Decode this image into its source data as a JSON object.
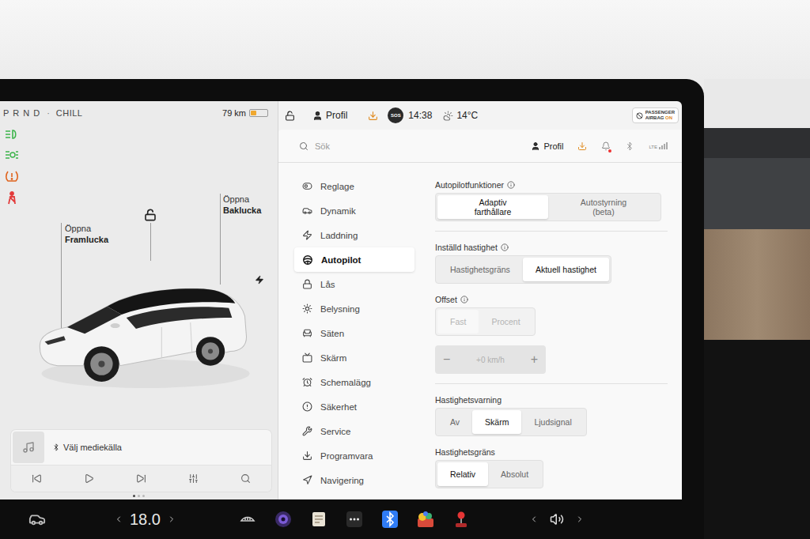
{
  "status_left": {
    "gears": "P R N D",
    "separator": "·",
    "drive_mode": "CHILL",
    "range": "79 km",
    "battery_level": 0.35
  },
  "status_right": {
    "locked": false,
    "profile": "Profil",
    "update_available": true,
    "sos": "SOS",
    "time": "14:38",
    "temperature": "14°C",
    "airbag": {
      "line1": "PASSENGER",
      "line2": "AIRBAG",
      "state": "ON"
    }
  },
  "car_view": {
    "locked": false,
    "callouts": [
      {
        "action": "Öppna",
        "part": "Framlucka"
      },
      {
        "action": "Öppna",
        "part": "Baklucka"
      }
    ]
  },
  "media": {
    "source": "Välj mediekälla",
    "page_dots": [
      {
        "selected": true
      },
      {
        "selected": false
      },
      {
        "selected": false
      }
    ]
  },
  "settings_header": {
    "search_placeholder": "Sök",
    "profile": "Profil",
    "network": "LTE"
  },
  "sidebar": {
    "items": [
      {
        "label": "Reglage",
        "selected": false
      },
      {
        "label": "Dynamik",
        "selected": false
      },
      {
        "label": "Laddning",
        "selected": false
      },
      {
        "label": "Autopilot",
        "selected": true
      },
      {
        "label": "Lås",
        "selected": false
      },
      {
        "label": "Belysning",
        "selected": false
      },
      {
        "label": "Säten",
        "selected": false
      },
      {
        "label": "Skärm",
        "selected": false
      },
      {
        "label": "Schemalägg",
        "selected": false
      },
      {
        "label": "Säkerhet",
        "selected": false
      },
      {
        "label": "Service",
        "selected": false
      },
      {
        "label": "Programvara",
        "selected": false
      },
      {
        "label": "Navigering",
        "selected": false
      }
    ]
  },
  "settings": {
    "sections": [
      {
        "label": "Autopilotfunktioner",
        "info": true,
        "disabled": false,
        "kind": "wide",
        "divider_after": true,
        "options": [
          {
            "label": "Adaptiv farthållare",
            "selected": true
          },
          {
            "label": "Autostyrning (beta)",
            "selected": false
          }
        ]
      },
      {
        "label": "Inställd hastighet",
        "info": true,
        "disabled": false,
        "kind": "fit",
        "divider_after": false,
        "options": [
          {
            "label": "Hastighetsgräns",
            "selected": false
          },
          {
            "label": "Aktuell hastighet",
            "selected": true
          }
        ]
      },
      {
        "label": "Offset",
        "info": true,
        "disabled": true,
        "kind": "fit",
        "divider_after": true,
        "options": [
          {
            "label": "Fast",
            "selected": true
          },
          {
            "label": "Procent",
            "selected": false
          }
        ],
        "stepper": {
          "minus": "−",
          "value": "+0 km/h",
          "plus": "+",
          "disabled": true
        }
      },
      {
        "label": "Hastighetsvarning",
        "info": false,
        "disabled": false,
        "kind": "fit",
        "divider_after": false,
        "options": [
          {
            "label": "Av",
            "selected": false
          },
          {
            "label": "Skärm",
            "selected": true
          },
          {
            "label": "Ljudsignal",
            "selected": false
          }
        ]
      },
      {
        "label": "Hastighetsgräns",
        "info": false,
        "disabled": false,
        "kind": "fit",
        "divider_after": false,
        "options": [
          {
            "label": "Relativ",
            "selected": true
          },
          {
            "label": "Absolut",
            "selected": false
          }
        ]
      }
    ]
  },
  "bottom_bar": {
    "cabin_temperature": "18.0"
  }
}
